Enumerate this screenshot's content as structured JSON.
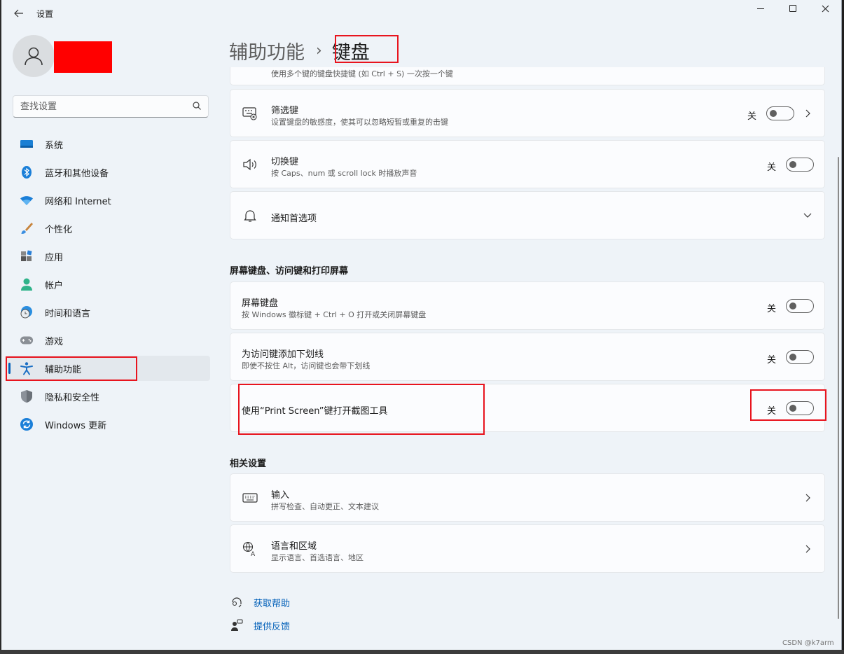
{
  "window": {
    "app_title": "设置",
    "back_icon": "arrow-left-icon",
    "controls": [
      "minimize-icon",
      "maximize-icon",
      "close-icon"
    ]
  },
  "sidebar": {
    "search": {
      "placeholder": "查找设置",
      "value": ""
    },
    "items": [
      {
        "label": "系统",
        "icon": "monitor-icon"
      },
      {
        "label": "蓝牙和其他设备",
        "icon": "bluetooth-icon"
      },
      {
        "label": "网络和 Internet",
        "icon": "wifi-icon"
      },
      {
        "label": "个性化",
        "icon": "brush-icon"
      },
      {
        "label": "应用",
        "icon": "apps-icon"
      },
      {
        "label": "帐户",
        "icon": "person-icon"
      },
      {
        "label": "时间和语言",
        "icon": "globe-clock-icon"
      },
      {
        "label": "游戏",
        "icon": "gamepad-icon"
      },
      {
        "label": "辅助功能",
        "icon": "accessibility-icon",
        "selected": true
      },
      {
        "label": "隐私和安全性",
        "icon": "shield-icon"
      },
      {
        "label": "Windows 更新",
        "icon": "sync-icon"
      }
    ]
  },
  "breadcrumb": {
    "parent": "辅助功能",
    "separator": "›",
    "current": "键盘"
  },
  "main": {
    "partial_row_desc": "使用多个键的键盘快捷键 (如 Ctrl + S) 一次按一个键",
    "filter_keys": {
      "title": "筛选键",
      "desc": "设置键盘的敏感度，使其可以忽略短暂或重复的击键",
      "state": "关"
    },
    "toggle_keys": {
      "title": "切换键",
      "desc": "按 Caps、num 或 scroll lock 时播放声音",
      "state": "关"
    },
    "notifications": {
      "title": "通知首选项"
    },
    "section_onscreen": "屏幕键盘、访问键和打印屏幕",
    "onscreen_keyboard": {
      "title": "屏幕键盘",
      "desc": "按 Windows 徽标键 + Ctrl + O 打开或关闭屏幕键盘",
      "state": "关"
    },
    "access_keys": {
      "title": "为访问键添加下划线",
      "desc": "即使不按住 Alt，访问键也会带下划线",
      "state": "关"
    },
    "print_screen": {
      "title": "使用“Print Screen”键打开截图工具",
      "state": "关"
    },
    "section_related": "相关设置",
    "typing": {
      "title": "输入",
      "desc": "拼写检查、自动更正、文本建议"
    },
    "language": {
      "title": "语言和区域",
      "desc": "显示语言、首选语言、地区"
    },
    "help_link": "获取帮助",
    "feedback_link": "提供反馈"
  },
  "watermark": "CSDN @k7arm",
  "colors": {
    "accent": "#005fb8",
    "annotation": "#e8141e",
    "redaction": "#ff0000"
  }
}
